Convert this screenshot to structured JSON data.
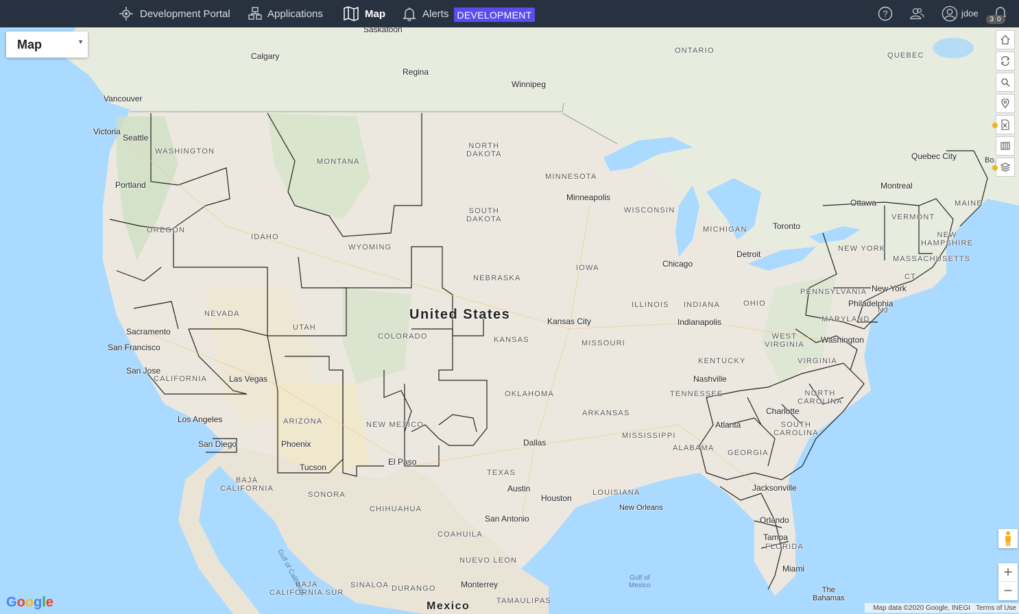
{
  "nav": {
    "portal": "Development Portal",
    "applications": "Applications",
    "map": "Map",
    "alerts": "Alerts",
    "environment": "DEVELOPMENT",
    "user": "jdoe",
    "notifications": "3 0"
  },
  "map_type": "Map",
  "map_labels": {
    "country": "United States",
    "mexico": "Mexico",
    "states": {
      "washington": "WASHINGTON",
      "oregon": "OREGON",
      "idaho": "IDAHO",
      "montana": "MONTANA",
      "wyoming": "WYOMING",
      "nevada": "NEVADA",
      "utah": "UTAH",
      "colorado": "COLORADO",
      "california": "CALIFORNIA",
      "arizona": "ARIZONA",
      "new_mexico": "NEW MEXICO",
      "north_dakota": "NORTH\nDAKOTA",
      "south_dakota": "SOUTH\nDAKOTA",
      "nebraska": "NEBRASKA",
      "kansas": "KANSAS",
      "oklahoma": "OKLAHOMA",
      "texas": "TEXAS",
      "minnesota": "MINNESOTA",
      "iowa": "IOWA",
      "missouri": "MISSOURI",
      "arkansas": "ARKANSAS",
      "louisiana": "LOUISIANA",
      "wisconsin": "WISCONSIN",
      "illinois": "ILLINOIS",
      "michigan": "MICHIGAN",
      "indiana": "INDIANA",
      "ohio": "OHIO",
      "kentucky": "KENTUCKY",
      "tennessee": "TENNESSEE",
      "mississippi": "MISSISSIPPI",
      "alabama": "ALABAMA",
      "georgia": "GEORGIA",
      "florida": "FLORIDA",
      "south_carolina": "SOUTH\nCAROLINA",
      "north_carolina": "NORTH\nCAROLINA",
      "virginia": "VIRGINIA",
      "west_virginia": "WEST\nVIRGINIA",
      "pennsylvania": "PENNSYLVANIA",
      "new_york": "NEW YORK",
      "vermont": "VERMONT",
      "new_hampshire": "NEW\nHAMPSHIRE",
      "massachusetts": "MASSACHUSETTS",
      "maine": "MAINE",
      "maryland": "MARYLAND",
      "ct": "CT",
      "nj": "NJ"
    },
    "provinces": {
      "ontario": "ONTARIO",
      "quebec": "QUEBEC",
      "baja_california": "BAJA\nCALIFORNIA",
      "sonora": "SONORA",
      "chihuahua": "CHIHUAHUA",
      "coahuila": "COAHUILA",
      "nuevo_leon": "NUEVO LEON",
      "baja_california_sur": "BAJA\nCALIFORNIA SUR",
      "sinaloa": "SINALOA",
      "durango": "DURANGO",
      "tamaulipas": "TAMAULIPAS"
    },
    "cities": {
      "saskatoon": "Saskatoon",
      "calgary": "Calgary",
      "regina": "Regina",
      "winnipeg": "Winnipeg",
      "vancouver": "Vancouver",
      "victoria": "Victoria",
      "seattle": "Seattle",
      "portland": "Portland",
      "sacramento": "Sacramento",
      "san_francisco": "San Francisco",
      "san_jose": "San Jose",
      "las_vegas": "Las Vegas",
      "los_angeles": "Los Angeles",
      "san_diego": "San Diego",
      "phoenix": "Phoenix",
      "tucson": "Tucson",
      "el_paso": "El Paso",
      "minneapolis": "Minneapolis",
      "chicago": "Chicago",
      "detroit": "Detroit",
      "toronto": "Toronto",
      "ottawa": "Ottawa",
      "montreal": "Montreal",
      "quebec_city": "Quebec City",
      "kansas_city": "Kansas City",
      "indianapolis": "Indianapolis",
      "nashville": "Nashville",
      "dallas": "Dallas",
      "austin": "Austin",
      "houston": "Houston",
      "san_antonio": "San Antonio",
      "new_orleans": "New Orleans",
      "atlanta": "Atlanta",
      "charlotte": "Charlotte",
      "jacksonville": "Jacksonville",
      "orlando": "Orlando",
      "tampa": "Tampa",
      "miami": "Miami",
      "washington": "Washington",
      "philadelphia": "Philadelphia",
      "new_york": "New York",
      "monterrey": "Monterrey",
      "bahamas": "The\nBahamas",
      "boston": "Bo..."
    },
    "water": {
      "gulf_of_mexico": "Gulf of\nMexico",
      "gulf_of_california": "Gulf of California"
    }
  },
  "attribution": {
    "data": "Map data ©2020 Google, INEGI",
    "terms": "Terms of Use"
  },
  "google": "Google",
  "icons": [
    "target-icon",
    "applications-icon",
    "map-icon",
    "bell-icon",
    "help-icon",
    "users-icon",
    "user-avatar-icon",
    "notification-bell-icon",
    "home-icon",
    "refresh-icon",
    "search-icon",
    "location-pin-icon",
    "excel-icon",
    "map-panel-icon",
    "layers-icon",
    "pegman-icon"
  ]
}
